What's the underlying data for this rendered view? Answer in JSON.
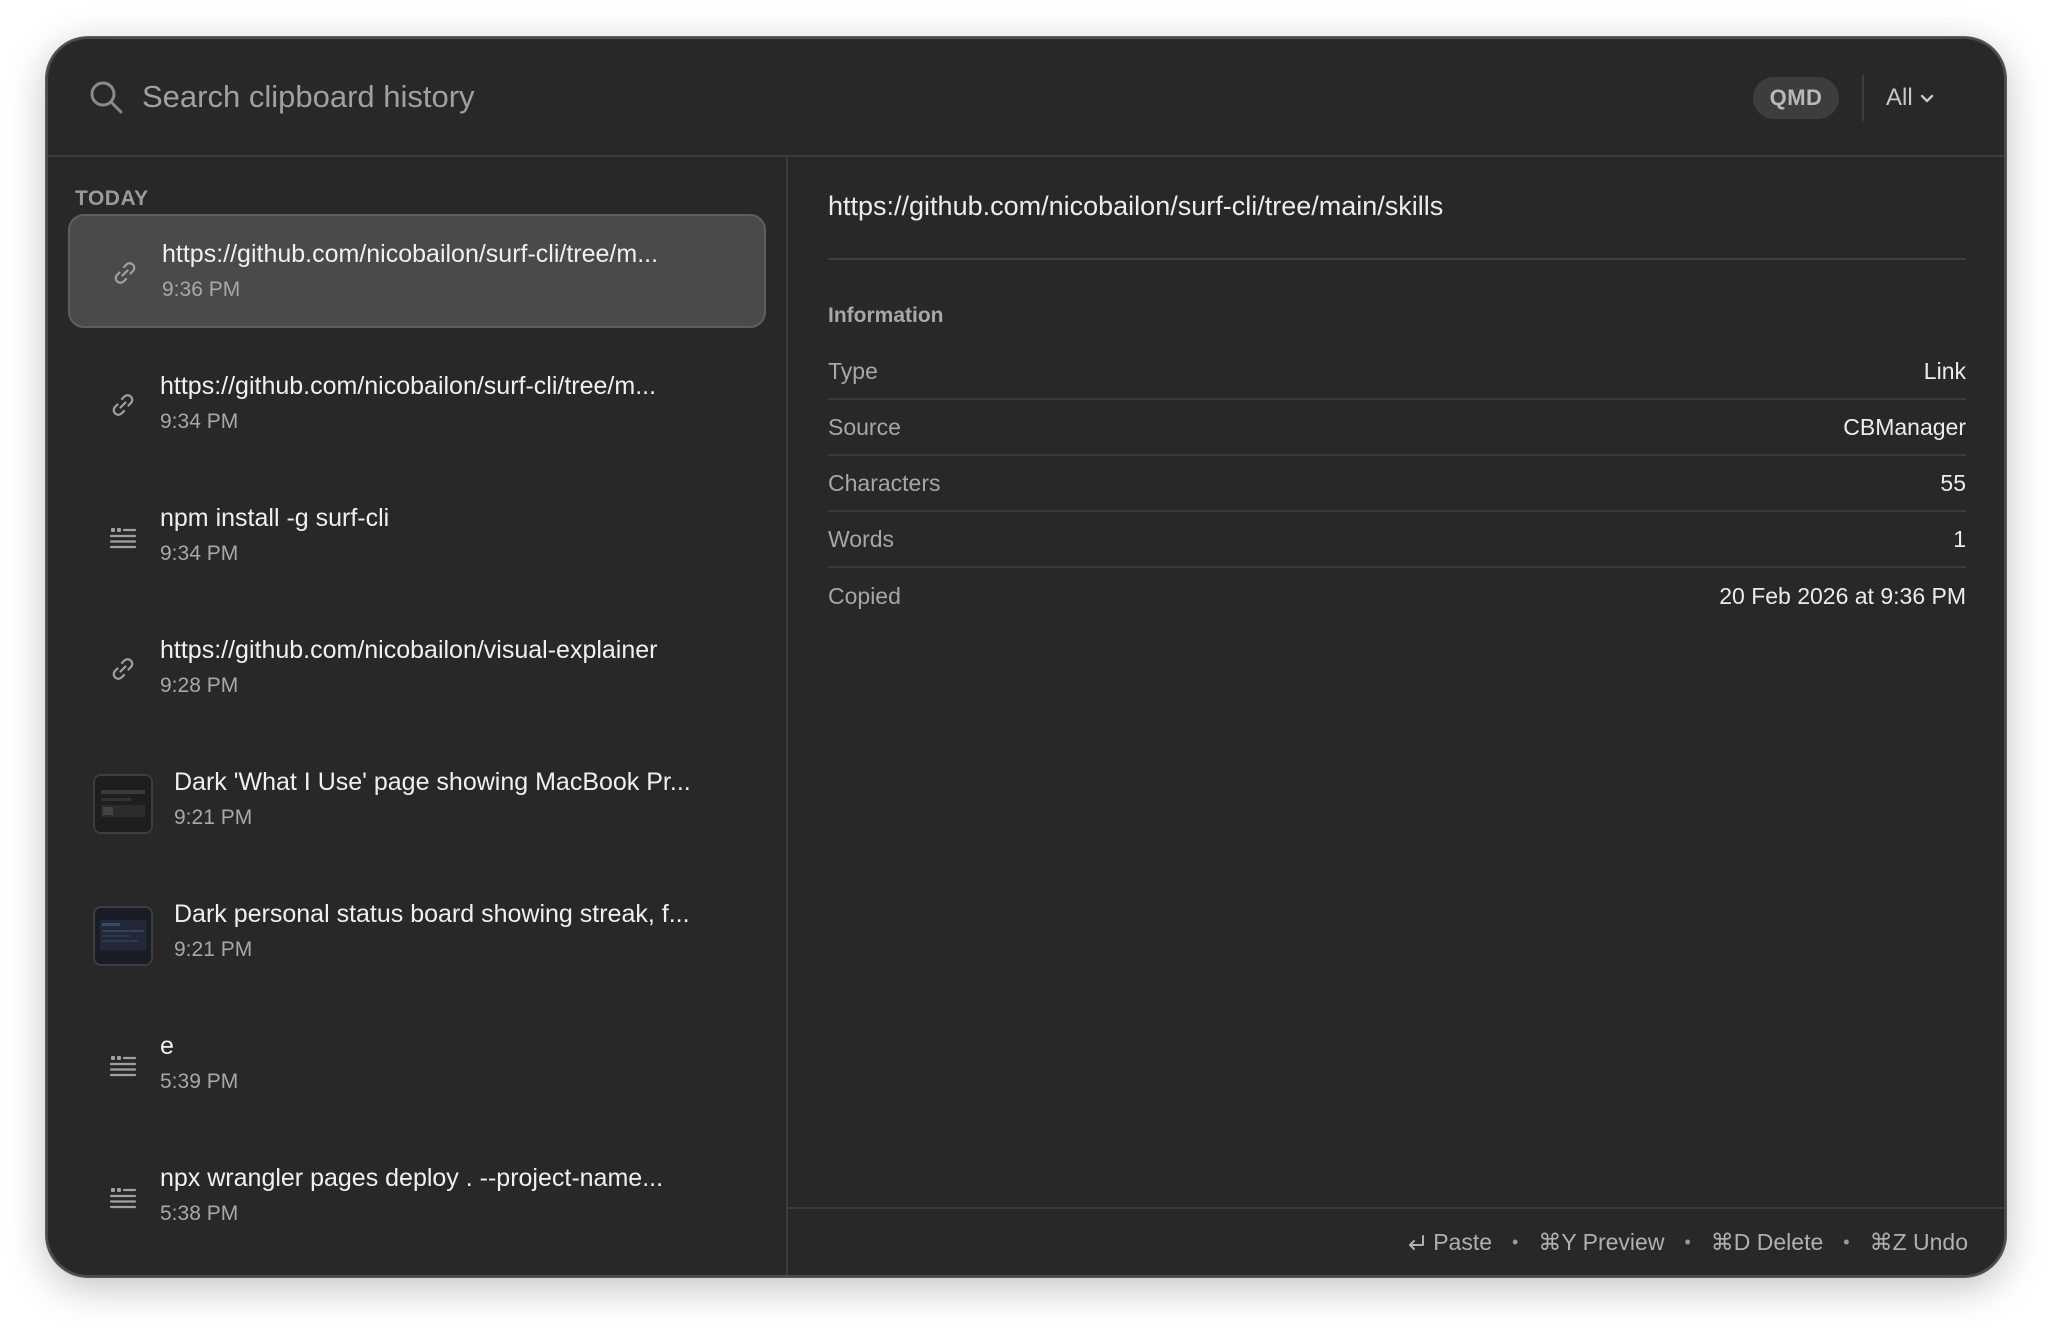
{
  "search": {
    "placeholder": "Search clipboard history",
    "badge": "QMD",
    "filter": "All"
  },
  "list": {
    "section": "TODAY",
    "items": [
      {
        "kind": "link",
        "title": "https://github.com/nicobailon/surf-cli/tree/m...",
        "time": "9:36 PM",
        "selected": true
      },
      {
        "kind": "link",
        "title": "https://github.com/nicobailon/surf-cli/tree/m...",
        "time": "9:34 PM"
      },
      {
        "kind": "text",
        "title": "npm install -g surf-cli",
        "time": "9:34 PM"
      },
      {
        "kind": "link",
        "title": "https://github.com/nicobailon/visual-explainer",
        "time": "9:28 PM"
      },
      {
        "kind": "image",
        "title": "Dark 'What I Use' page showing MacBook Pr...",
        "time": "9:21 PM"
      },
      {
        "kind": "image",
        "title": "Dark personal status board showing streak, f...",
        "time": "9:21 PM"
      },
      {
        "kind": "text",
        "title": "e",
        "time": "5:39 PM"
      },
      {
        "kind": "text",
        "title": "npx wrangler pages deploy . --project-name...",
        "time": "5:38 PM"
      }
    ]
  },
  "detail": {
    "url": "https://github.com/nicobailon/surf-cli/tree/main/skills",
    "info_heading": "Information",
    "info": [
      {
        "key": "Type",
        "value": "Link"
      },
      {
        "key": "Source",
        "value": "CBManager"
      },
      {
        "key": "Characters",
        "value": "55"
      },
      {
        "key": "Words",
        "value": "1"
      },
      {
        "key": "Copied",
        "value": "20 Feb 2026 at 9:36 PM"
      }
    ]
  },
  "footer": {
    "paste": "Paste",
    "preview": "⌘Y Preview",
    "delete": "⌘D Delete",
    "undo": "⌘Z Undo",
    "separator": "•"
  }
}
